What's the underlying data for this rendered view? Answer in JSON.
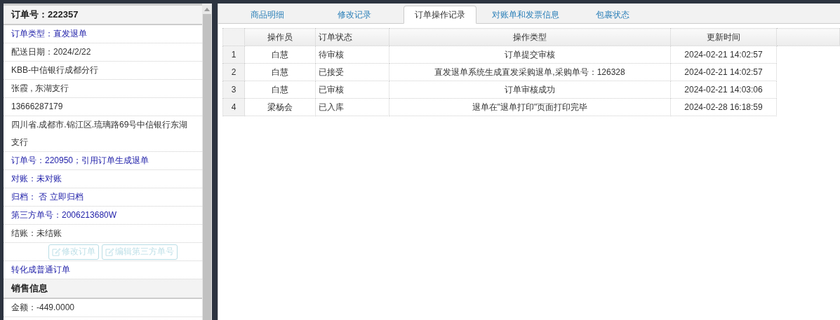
{
  "sidebar": {
    "items": [
      {
        "kind": "section",
        "text": "订单号：222357"
      },
      {
        "kind": "link",
        "text": "订单类型：直发退单"
      },
      {
        "kind": "text",
        "text": "配送日期：2024/2/22"
      },
      {
        "kind": "text",
        "text": "KBB-中信银行成都分行"
      },
      {
        "kind": "text",
        "text": "张霞 , 东湖支行"
      },
      {
        "kind": "text",
        "text": "13666287179"
      },
      {
        "kind": "text",
        "text": "四川省.成都市.锦江区.琉璃路69号中信银行东湖支行"
      },
      {
        "kind": "link",
        "text": "订单号：220950；引用订单生成退单"
      },
      {
        "kind": "link",
        "text": "对账：未对账"
      },
      {
        "kind": "link",
        "text": "归档： 否 立即归档"
      },
      {
        "kind": "link",
        "text": "第三方单号：2006213680W"
      },
      {
        "kind": "text",
        "text": "结账：未结账"
      },
      {
        "kind": "buttons",
        "buttons": [
          {
            "label": "修改订单",
            "disabled": true
          },
          {
            "label": "编辑第三方单号",
            "disabled": true
          }
        ]
      },
      {
        "kind": "link",
        "text": "转化成普通订单"
      },
      {
        "kind": "section",
        "text": "销售信息"
      },
      {
        "kind": "text",
        "text": "金额：-449.0000"
      }
    ]
  },
  "tabs": [
    {
      "label": "商品明细",
      "selected": false
    },
    {
      "label": "修改记录",
      "selected": false
    },
    {
      "label": "订单操作记录",
      "selected": true
    },
    {
      "label": "对账单和发票信息",
      "selected": false
    },
    {
      "label": "包裹状态",
      "selected": false
    }
  ],
  "table": {
    "columns": [
      "操作员",
      "订单状态",
      "操作类型",
      "更新时间"
    ],
    "rows": [
      {
        "index": "1",
        "cells": [
          "白慧",
          "待审核",
          "订单提交审核",
          "2024-02-21 14:02:57"
        ]
      },
      {
        "index": "2",
        "cells": [
          "白慧",
          "已接受",
          "直发退单系统生成直发采购退单,采购单号：126328",
          "2024-02-21 14:02:57"
        ]
      },
      {
        "index": "3",
        "cells": [
          "白慧",
          "已审核",
          "订单审核成功",
          "2024-02-21 14:03:06"
        ]
      },
      {
        "index": "4",
        "cells": [
          "梁杨会",
          "已入库",
          "退单在\"退单打印\"页面打印完毕",
          "2024-02-28 16:18:59"
        ]
      }
    ]
  }
}
